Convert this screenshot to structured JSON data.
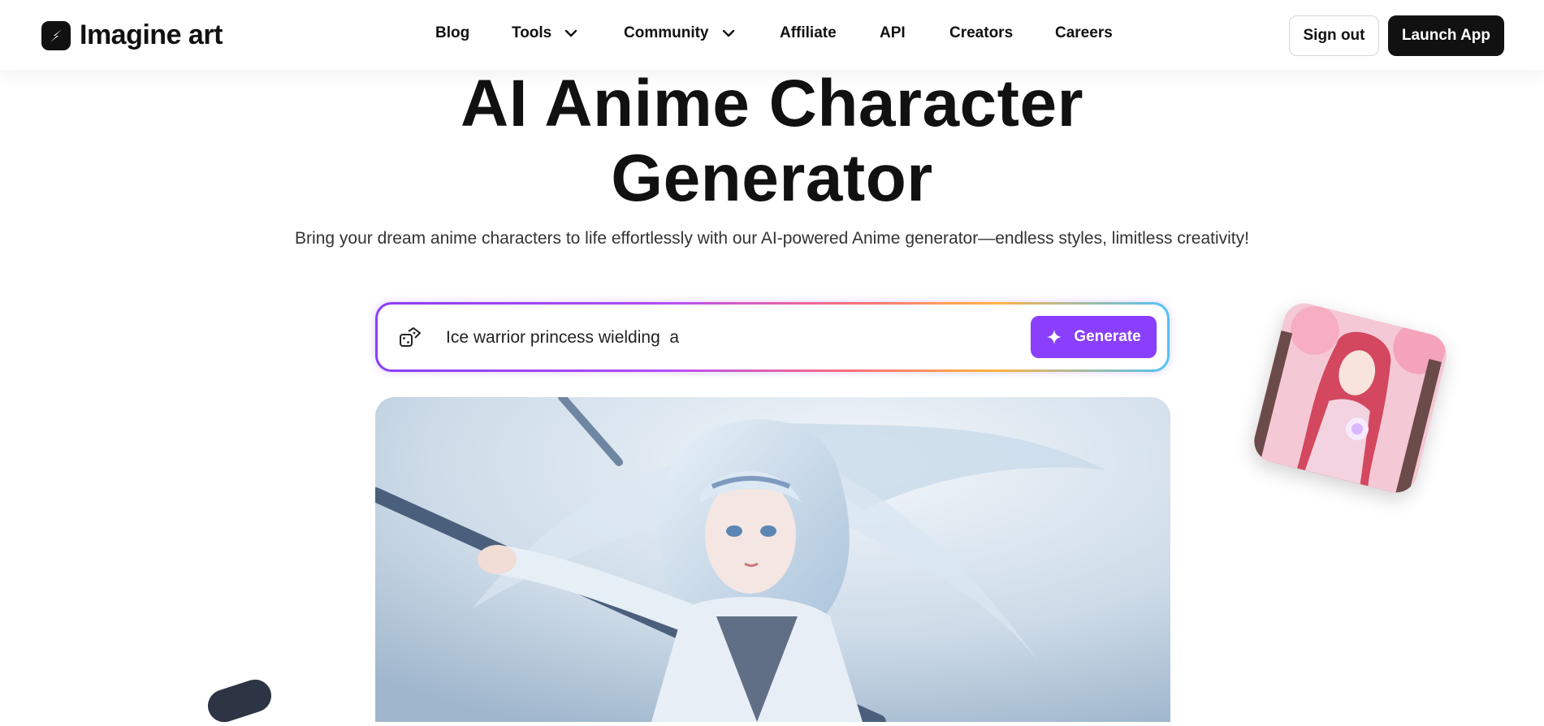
{
  "brand": {
    "name": "Imagine art"
  },
  "nav": {
    "items": [
      {
        "label": "Blog"
      },
      {
        "label": "Tools"
      },
      {
        "label": "Community"
      },
      {
        "label": "Affiliate"
      },
      {
        "label": "API"
      },
      {
        "label": "Creators"
      },
      {
        "label": "Careers"
      }
    ]
  },
  "header_actions": {
    "sign_out": "Sign out",
    "launch_app": "Launch App"
  },
  "hero": {
    "title_line1": "AI Anime Character",
    "title_line2": "Generator",
    "subtitle": "Bring your dream anime characters to life effortlessly with our AI-powered Anime generator—endless styles, limitless creativity!"
  },
  "prompt": {
    "value": "Ice warrior princess wielding  a",
    "generate_label": "Generate"
  },
  "colors": {
    "accent": "#8a3ffc",
    "dark": "#111111"
  },
  "icons": {
    "prompt_left": "dice-icon",
    "generate": "sparkle-icon",
    "dropdown": "chevron-down-icon"
  }
}
